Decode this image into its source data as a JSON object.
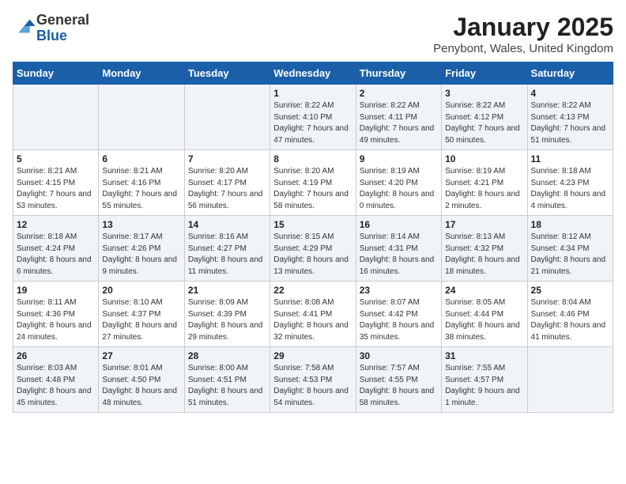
{
  "header": {
    "logo_general": "General",
    "logo_blue": "Blue",
    "title": "January 2025",
    "subtitle": "Penybont, Wales, United Kingdom"
  },
  "days_of_week": [
    "Sunday",
    "Monday",
    "Tuesday",
    "Wednesday",
    "Thursday",
    "Friday",
    "Saturday"
  ],
  "weeks": [
    [
      {
        "day": "",
        "info": ""
      },
      {
        "day": "",
        "info": ""
      },
      {
        "day": "",
        "info": ""
      },
      {
        "day": "1",
        "info": "Sunrise: 8:22 AM\nSunset: 4:10 PM\nDaylight: 7 hours and 47 minutes."
      },
      {
        "day": "2",
        "info": "Sunrise: 8:22 AM\nSunset: 4:11 PM\nDaylight: 7 hours and 49 minutes."
      },
      {
        "day": "3",
        "info": "Sunrise: 8:22 AM\nSunset: 4:12 PM\nDaylight: 7 hours and 50 minutes."
      },
      {
        "day": "4",
        "info": "Sunrise: 8:22 AM\nSunset: 4:13 PM\nDaylight: 7 hours and 51 minutes."
      }
    ],
    [
      {
        "day": "5",
        "info": "Sunrise: 8:21 AM\nSunset: 4:15 PM\nDaylight: 7 hours and 53 minutes."
      },
      {
        "day": "6",
        "info": "Sunrise: 8:21 AM\nSunset: 4:16 PM\nDaylight: 7 hours and 55 minutes."
      },
      {
        "day": "7",
        "info": "Sunrise: 8:20 AM\nSunset: 4:17 PM\nDaylight: 7 hours and 56 minutes."
      },
      {
        "day": "8",
        "info": "Sunrise: 8:20 AM\nSunset: 4:19 PM\nDaylight: 7 hours and 58 minutes."
      },
      {
        "day": "9",
        "info": "Sunrise: 8:19 AM\nSunset: 4:20 PM\nDaylight: 8 hours and 0 minutes."
      },
      {
        "day": "10",
        "info": "Sunrise: 8:19 AM\nSunset: 4:21 PM\nDaylight: 8 hours and 2 minutes."
      },
      {
        "day": "11",
        "info": "Sunrise: 8:18 AM\nSunset: 4:23 PM\nDaylight: 8 hours and 4 minutes."
      }
    ],
    [
      {
        "day": "12",
        "info": "Sunrise: 8:18 AM\nSunset: 4:24 PM\nDaylight: 8 hours and 6 minutes."
      },
      {
        "day": "13",
        "info": "Sunrise: 8:17 AM\nSunset: 4:26 PM\nDaylight: 8 hours and 9 minutes."
      },
      {
        "day": "14",
        "info": "Sunrise: 8:16 AM\nSunset: 4:27 PM\nDaylight: 8 hours and 11 minutes."
      },
      {
        "day": "15",
        "info": "Sunrise: 8:15 AM\nSunset: 4:29 PM\nDaylight: 8 hours and 13 minutes."
      },
      {
        "day": "16",
        "info": "Sunrise: 8:14 AM\nSunset: 4:31 PM\nDaylight: 8 hours and 16 minutes."
      },
      {
        "day": "17",
        "info": "Sunrise: 8:13 AM\nSunset: 4:32 PM\nDaylight: 8 hours and 18 minutes."
      },
      {
        "day": "18",
        "info": "Sunrise: 8:12 AM\nSunset: 4:34 PM\nDaylight: 8 hours and 21 minutes."
      }
    ],
    [
      {
        "day": "19",
        "info": "Sunrise: 8:11 AM\nSunset: 4:36 PM\nDaylight: 8 hours and 24 minutes."
      },
      {
        "day": "20",
        "info": "Sunrise: 8:10 AM\nSunset: 4:37 PM\nDaylight: 8 hours and 27 minutes."
      },
      {
        "day": "21",
        "info": "Sunrise: 8:09 AM\nSunset: 4:39 PM\nDaylight: 8 hours and 29 minutes."
      },
      {
        "day": "22",
        "info": "Sunrise: 8:08 AM\nSunset: 4:41 PM\nDaylight: 8 hours and 32 minutes."
      },
      {
        "day": "23",
        "info": "Sunrise: 8:07 AM\nSunset: 4:42 PM\nDaylight: 8 hours and 35 minutes."
      },
      {
        "day": "24",
        "info": "Sunrise: 8:05 AM\nSunset: 4:44 PM\nDaylight: 8 hours and 38 minutes."
      },
      {
        "day": "25",
        "info": "Sunrise: 8:04 AM\nSunset: 4:46 PM\nDaylight: 8 hours and 41 minutes."
      }
    ],
    [
      {
        "day": "26",
        "info": "Sunrise: 8:03 AM\nSunset: 4:48 PM\nDaylight: 8 hours and 45 minutes."
      },
      {
        "day": "27",
        "info": "Sunrise: 8:01 AM\nSunset: 4:50 PM\nDaylight: 8 hours and 48 minutes."
      },
      {
        "day": "28",
        "info": "Sunrise: 8:00 AM\nSunset: 4:51 PM\nDaylight: 8 hours and 51 minutes."
      },
      {
        "day": "29",
        "info": "Sunrise: 7:58 AM\nSunset: 4:53 PM\nDaylight: 8 hours and 54 minutes."
      },
      {
        "day": "30",
        "info": "Sunrise: 7:57 AM\nSunset: 4:55 PM\nDaylight: 8 hours and 58 minutes."
      },
      {
        "day": "31",
        "info": "Sunrise: 7:55 AM\nSunset: 4:57 PM\nDaylight: 9 hours and 1 minute."
      },
      {
        "day": "",
        "info": ""
      }
    ]
  ]
}
